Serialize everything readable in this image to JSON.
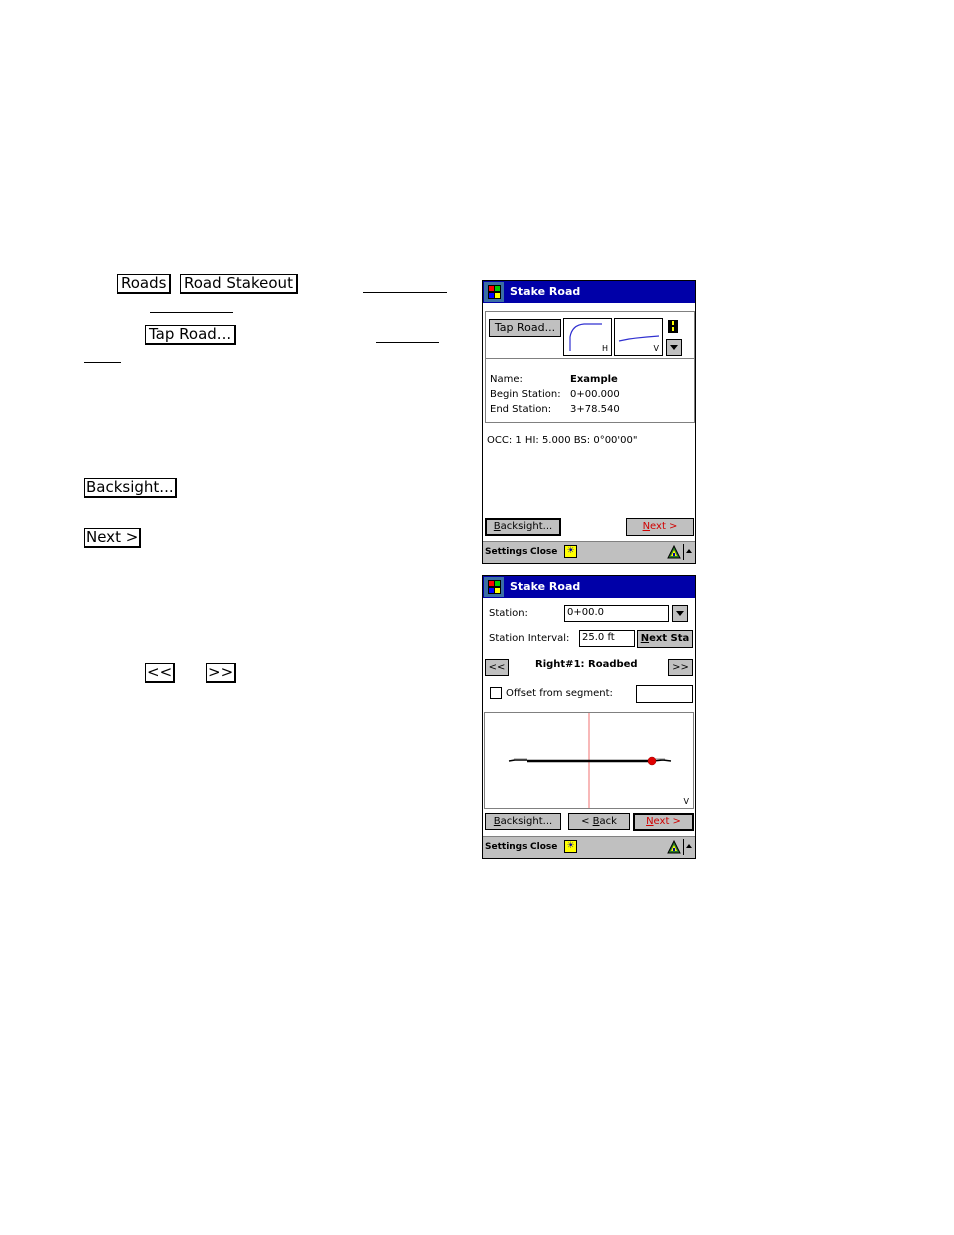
{
  "doc": {
    "buttons": {
      "roads": "Roads",
      "road_stakeout": "Road Stakeout",
      "tap_road": "Tap Road...",
      "backsight": "Backsight...",
      "next": "Next >",
      "prev_seg": "<<",
      "next_seg": ">>"
    }
  },
  "screen1": {
    "title": "Stake Road",
    "tap_road_button": "Tap Road...",
    "h_label": "H",
    "v_label": "V",
    "info": {
      "name_label": "Name:",
      "name_value": "Example",
      "begin_label": "Begin Station:",
      "begin_value": "0+00.000",
      "end_label": "End Station:",
      "end_value": "3+78.540"
    },
    "occ_line": "OCC: 1  HI: 5.000  BS: 0°00'00\"",
    "backsight_prefix": "B",
    "backsight_rest": "acksight...",
    "next_prefix": "N",
    "next_rest": "ext >",
    "statusbar": {
      "settings": "Settings",
      "close": "Close"
    }
  },
  "screen2": {
    "title": "Stake Road",
    "station_label": "Station:",
    "station_value": "0+00.0",
    "interval_label": "Station Interval:",
    "interval_value": "25.0 ft",
    "next_sta_prefix": "N",
    "next_sta_rest": "ext Sta",
    "prev_button": "<<",
    "next_button": ">>",
    "segment_label": "Right#1:  Roadbed",
    "offset_label": "Offset from segment:",
    "offset_checked": false,
    "offset_value": "",
    "view_label": "V",
    "backsight_prefix": "B",
    "backsight_rest": "acksight...",
    "back_prefix": "< ",
    "back_ul": "B",
    "back_rest": "ack",
    "next_prefix": "N",
    "next_rest": "ext >",
    "statusbar": {
      "settings": "Settings",
      "close": "Close"
    }
  },
  "colors": {
    "titlebar": "#0000a8",
    "accent_red": "#d00000",
    "status_yellow": "#ffff00"
  }
}
